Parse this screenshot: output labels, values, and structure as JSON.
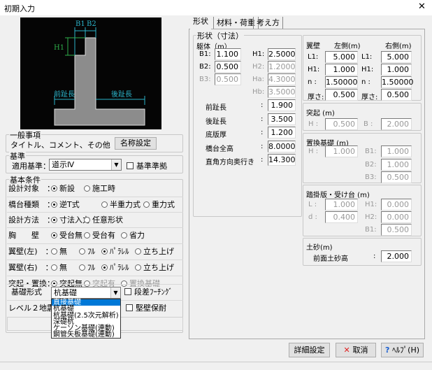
{
  "window": {
    "title": "初期入力",
    "close": "✕"
  },
  "diagram": {
    "b1": "B1",
    "b2": "B2",
    "h1": "H1",
    "front_toe": "前趾長",
    "rear_toe": "後趾長"
  },
  "general": {
    "legend": "一般事項",
    "text": "タイトル、コメント、その他",
    "name_button": "名称設定"
  },
  "standard": {
    "legend": "基準",
    "label": "適用基準：",
    "value": "道示Ⅳ",
    "check_label": "基準準拠",
    "checked": false
  },
  "basic": {
    "legend": "基本条件",
    "rows": [
      {
        "label": "設計対象　：",
        "options": [
          "新設",
          "施工時"
        ],
        "selected": 0,
        "disabled": []
      },
      {
        "label": "橋台種類　：",
        "options": [
          "逆T式",
          "半重力式",
          "重力式"
        ],
        "selected": 0,
        "disabled": []
      },
      {
        "label": "設計方法　：",
        "options": [
          "寸法入力",
          "任意形状"
        ],
        "selected": 0,
        "disabled": []
      },
      {
        "label": "胸　　壁",
        "options": [
          "受台無",
          "受台有",
          "省力"
        ],
        "selected": 0,
        "disabled": []
      },
      {
        "label": "翼壁(左)　：",
        "options": [
          "無",
          "ﾌﾙ",
          "ﾊﾟﾗﾚﾙ",
          "立ち上げ"
        ],
        "selected": 2,
        "disabled": []
      },
      {
        "label": "翼壁(右)　：",
        "options": [
          "無",
          "ﾌﾙ",
          "ﾊﾟﾗﾚﾙ",
          "立ち上げ"
        ],
        "selected": 2,
        "disabled": []
      },
      {
        "label": "突起・置換：",
        "options": [
          "突起無",
          "突起有",
          "置換基礎"
        ],
        "selected": 0,
        "disabled": [
          1,
          2
        ]
      }
    ],
    "foundation_label": "基礎形式　：",
    "foundation_value": "杭基礎",
    "step_footing": "段差ﾌｰﾁﾝｸﾞ",
    "level2_label": "レベル２地震時",
    "wall_check": "堅壁保耐",
    "foundation_options": [
      "直接基礎",
      "杭基礎",
      "杭基礎(2.5次元解析)",
      "深礎杭",
      "ケーソン基礎(連動)",
      "鋼管矢板基礎(連動)"
    ],
    "highlighted": 0
  },
  "tabs": [
    "形状",
    "材料・荷重",
    "考え方"
  ],
  "active_tab": 0,
  "shape": {
    "legend": "形状（寸法）",
    "body_label": "躯体（m）",
    "b1": {
      "label": "B1:",
      "value": "1.100"
    },
    "b2": {
      "label": "B2:",
      "value": "0.500"
    },
    "b3": {
      "label": "B3:",
      "value": "0.500"
    },
    "h1": {
      "label": "H1:",
      "value": "2.5000"
    },
    "h2": {
      "label": "H2:",
      "value": "1.2000"
    },
    "ha": {
      "label": "Ha:",
      "value": "4.3000"
    },
    "hb": {
      "label": "Hb:",
      "value": "3.5000"
    },
    "items": [
      {
        "label": "前趾長",
        "value": "1.900"
      },
      {
        "label": "後趾長",
        "value": "3.500"
      },
      {
        "label": "底版厚",
        "value": "1.200"
      },
      {
        "label": "橋台全高",
        "value": "8.0000"
      },
      {
        "label": "直角方向奥行き",
        "value": "14.300"
      }
    ],
    "colon": ":"
  },
  "wing": {
    "title": "翼壁",
    "left": "左側(m)",
    "right": "右側(m)",
    "rows": [
      {
        "label": "L1:",
        "l": "5.000",
        "r": "5.000"
      },
      {
        "label": "H1:",
        "l": "1.000",
        "r": "1.000"
      },
      {
        "label": "n :",
        "l": "1.50000",
        "r": "1.50000"
      },
      {
        "label": "厚さ:",
        "l": "0.500",
        "r": "0.500"
      }
    ]
  },
  "projection": {
    "title": "突起 (m)",
    "h_label": "H :",
    "h": "0.500",
    "b_label": "B :",
    "b": "2.000"
  },
  "replace": {
    "title": "置換基礎 (m)",
    "h_label": "H :",
    "h": "1.000",
    "b1_label": "B1:",
    "b1": "1.000",
    "b2_label": "B2:",
    "b2": "1.000",
    "b3_label": "B3:",
    "b3": "0.500"
  },
  "approach": {
    "title": "踏掛版・受け台 (m)",
    "l_label": "L :",
    "l": "1.000",
    "d_label": "d :",
    "d": "0.400",
    "h1_label": "H1:",
    "h1": "0.000",
    "h2_label": "H2:",
    "h2": "0.000",
    "b1_label": "B1:",
    "b1": "0.500"
  },
  "soil": {
    "title": "土砂(m)",
    "label": "前面土砂高",
    "colon": ":",
    "value": "2.000"
  },
  "buttons": {
    "detail": "詳細設定",
    "cancel": "取消",
    "help": "ﾍﾙﾌﾟ(H)"
  }
}
